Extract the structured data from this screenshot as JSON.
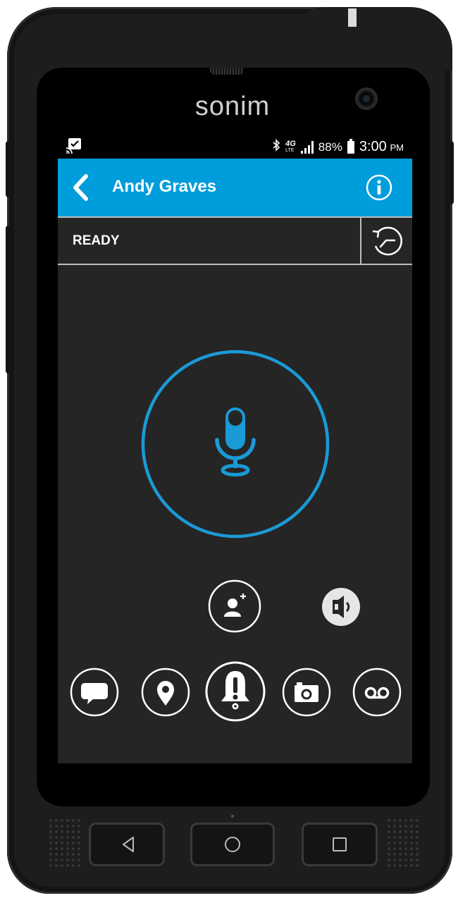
{
  "device": {
    "brand": "sonim"
  },
  "status_bar": {
    "notification_icon": "cast-screen-icon",
    "bluetooth_icon": "bluetooth-icon",
    "network": "4G",
    "network_sub": "LTE",
    "battery_percent": "88%",
    "time": "3:00",
    "ampm": "PM"
  },
  "header": {
    "back_icon": "chevron-left-icon",
    "title": "Andy Graves",
    "info_icon": "info-icon"
  },
  "status_row": {
    "status": "READY",
    "history_icon": "call-history-icon"
  },
  "ptt": {
    "icon": "microphone-icon",
    "accent": "#1a9ad6"
  },
  "actions": {
    "add_contact_icon": "add-contact-icon",
    "speaker_icon": "speaker-icon",
    "message_icon": "message-icon",
    "location_icon": "location-pin-icon",
    "alert_icon": "bell-alert-icon",
    "camera_icon": "camera-icon",
    "voicemail_icon": "voicemail-icon"
  },
  "nav_keys": {
    "back_icon": "nav-back-icon",
    "home_icon": "nav-home-icon",
    "recents_icon": "nav-recents-icon"
  },
  "colors": {
    "header_blue": "#009ddc",
    "screen_bg": "#252525"
  }
}
